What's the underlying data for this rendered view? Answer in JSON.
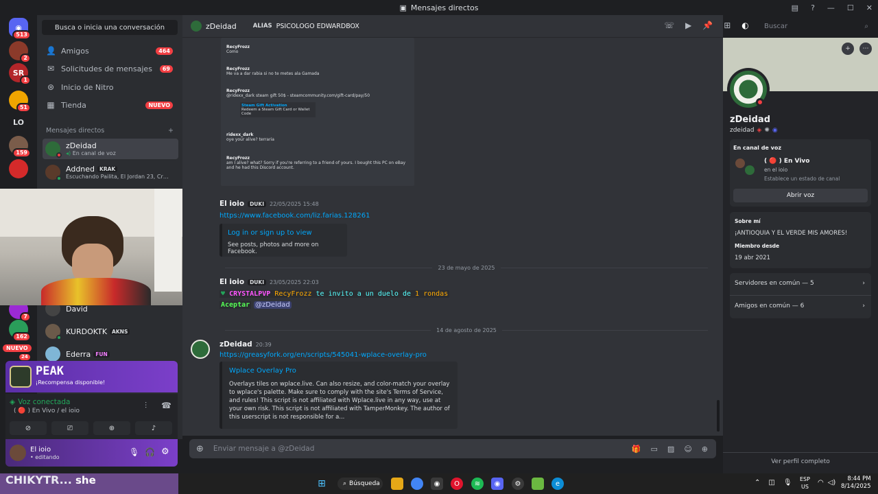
{
  "window": {
    "title": "Mensajes directos",
    "icon": "discord-dm-icon"
  },
  "rail": {
    "home_badge": "513",
    "servers": [
      {
        "name": "server-1",
        "badge": "2",
        "color": "#c0392b"
      },
      {
        "name": "server-sr",
        "badge": "1",
        "color": "#b3262a"
      },
      {
        "name": "server-3",
        "badge": "51",
        "color": "#f0a500"
      },
      {
        "name": "server-lo",
        "label": "LO",
        "color": "#2b2d31"
      },
      {
        "name": "server-5",
        "badge": "159",
        "color": "#7a5c4a"
      },
      {
        "name": "server-6",
        "badge": "",
        "color": "#d42a2a"
      },
      {
        "name": "server-7",
        "badge": "7",
        "color": "#9b2ad4"
      },
      {
        "name": "server-8",
        "badge": "162",
        "color": "#2a9d5a"
      }
    ],
    "new_badge": "NUEVO",
    "new_badge_count": "24"
  },
  "sidebar": {
    "search_label": "Busca o inicia una conversación",
    "nav": [
      {
        "label": "Amigos",
        "badge": "464",
        "icon": "friends-icon"
      },
      {
        "label": "Solicitudes de mensajes",
        "badge": "69",
        "icon": "mail-icon"
      },
      {
        "label": "Inicio de Nitro",
        "badge": "",
        "icon": "nitro-icon"
      },
      {
        "label": "Tienda",
        "badge": "NUEVO",
        "icon": "shop-icon"
      }
    ],
    "dm_header": "Mensajes directos",
    "dm_add": "+",
    "dms": [
      {
        "name": "zDeidad",
        "sub": "En canal de voz",
        "tag": "",
        "active": true
      },
      {
        "name": "Addned",
        "sub": "Escuchando Pailita, El Jordan 23, Cris ...",
        "tag": "KRAK",
        "active": false
      },
      {
        "name": "David",
        "sub": "",
        "tag": "",
        "active": false
      },
      {
        "name": "KURDOKTK",
        "sub": "",
        "tag": "AKNS",
        "active": false
      },
      {
        "name": "Ederra",
        "sub": "",
        "tag": "FUN",
        "active": false
      }
    ]
  },
  "promo": {
    "title": "PEAK",
    "subtitle": "¡Recompensa disponible!"
  },
  "voice": {
    "status": "Voz conectada",
    "channel": "( 🔴 ) En Vivo / el ioio"
  },
  "user": {
    "name": "El ioio",
    "status": "• editando"
  },
  "chat_header": {
    "name": "zDeidad",
    "alias_label": "ALIAS",
    "alias": "PSICOLOGO EDWARDBOX",
    "search_placeholder": "Buscar"
  },
  "chat": {
    "screenshot_lines": [
      {
        "author": "RecyFrozz",
        "text": "Como"
      },
      {
        "author": "RecyFrozz",
        "text": "Me va a dar rabia si no te metes ala Gamada"
      },
      {
        "author": "RecyFrozz",
        "text": "@ridexx_dark steam gift 50$ - steamcommunity.com/gift-card/pay/50"
      },
      {
        "author": "Steam Gift Activation",
        "text": "Redeem a Steam Gift Card or Wallet Code"
      },
      {
        "author": "ridexx_dark",
        "text": "oye your alive? terraria"
      },
      {
        "author": "RecyFrozz",
        "text": "am I alive? what? Sorry if you're referring to a friend of yours. I bought this PC on eBay and he had this Discord account."
      }
    ],
    "msg1": {
      "author": "El ioio",
      "tag": "DUKI",
      "time": "22/05/2025 15:48",
      "link": "https://www.facebook.com/liz.farias.128261",
      "embed_title": "Log in or sign up to view",
      "embed_desc": "See posts, photos and more on Facebook."
    },
    "divider1": "23 de mayo de 2025",
    "msg2": {
      "author": "El ioio",
      "tag": "DUKI",
      "time": "23/05/2025 22:03",
      "line1_prefix": "CRYSTALPVP",
      "line1_user": "RecyFrozz",
      "line1_mid": "te invito a un duelo de",
      "line1_count": "1 rondas",
      "line2": "Aceptar",
      "mention": "@zDeidad"
    },
    "divider2": "14 de agosto de 2025",
    "msg3": {
      "author": "zDeidad",
      "time": "20:39",
      "link": "https://greasyfork.org/en/scripts/545041-wplace-overlay-pro",
      "embed_title": "Wplace Overlay Pro",
      "embed_desc": "Overlays tiles on wplace.live. Can also resize, and color-match your overlay to wplace's palette. Make sure to comply with the site's Terms of Service, and rules! This script is not affiliated with Wplace.live in any way, use at your own risk. This script is not affiliated with TamperMonkey. The author of this userscript is not responsible for a..."
    },
    "input_placeholder": "Enviar mensaje a @zDeidad"
  },
  "profile": {
    "display_name": "zDeidad",
    "username": "zdeidad",
    "voice_header": "En canal de voz",
    "voice_channel": "( 🔴 ) En Vivo",
    "voice_server": "en el ioio",
    "voice_status": "Establece un estado de canal",
    "open_voice": "Abrir voz",
    "about_header": "Sobre mí",
    "about_text": "¡ANTIOQUIA Y EL VERDE MIS AMORES!",
    "member_header": "Miembro desde",
    "member_date": "19 abr 2021",
    "servers_common": "Servidores en común — 5",
    "friends_common": "Amigos en común — 6",
    "view_full": "Ver perfil completo",
    "banner_color": "#c9cdbf"
  },
  "overlay": {
    "text1": "CHIKYTR...",
    "text2": "she"
  },
  "taskbar": {
    "search": "Búsqueda",
    "lang": "ESP",
    "region": "US",
    "time": "8:44 PM",
    "date": "8/14/2025"
  },
  "colors": {
    "accent": "#5865f2",
    "link": "#00a8fc",
    "online": "#23a55a",
    "dnd": "#f23f43"
  }
}
